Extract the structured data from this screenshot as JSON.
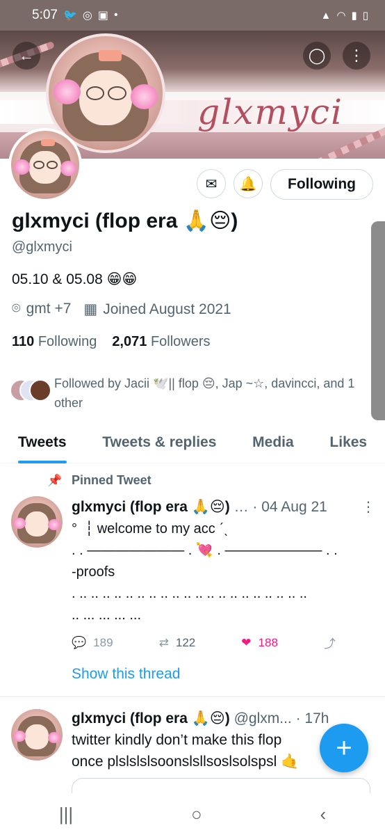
{
  "status_bar": {
    "time": "5:07",
    "left_icons": [
      "twitter-bird-icon",
      "instagram-threads-icon",
      "gallery-icon",
      "dot-icon"
    ],
    "right_icons": [
      "sim-lock-icon",
      "wifi-icon",
      "signal-icon",
      "battery-icon"
    ]
  },
  "banner": {
    "name_text": "glxmyci"
  },
  "header_buttons": {
    "back_icon": "back-arrow-icon",
    "search_icon": "search-icon",
    "more_icon": "more-vertical-icon"
  },
  "profile_actions": {
    "message_icon": "mail-icon",
    "notify_icon": "bell-check-icon",
    "follow_label": "Following"
  },
  "profile": {
    "display_name": "glxmyci (flop era 🙏😔)",
    "handle": "@glxmyci",
    "bio": "05.10 & 05.08 😁😁",
    "location": "gmt +7",
    "joined": "Joined August 2021",
    "following_count": "110",
    "following_label": "Following",
    "followers_count": "2,071",
    "followers_label": "Followers",
    "followed_by": "Followed by Jacii 🕊️|| flop 😔, Jap ~☆, davincci, and 1 other"
  },
  "tabs": [
    {
      "label": "Tweets",
      "active": true
    },
    {
      "label": "Tweets & replies",
      "active": false
    },
    {
      "label": "Media",
      "active": false
    },
    {
      "label": "Likes",
      "active": false
    }
  ],
  "tweets": [
    {
      "pinned_label": "Pinned Tweet",
      "name": "glxmyci (flop era 🙏😔)",
      "meta": "… · 04 Aug 21",
      "text": "°  ︎  ┆ welcome to my acc ˊˎ\n. . ——————— . 💘 . ——————— . .\n-proofs\n. .. .. .. .. .. .. .. .. .. .. .. .. .. .. .. .. .. .. .. ..\n.. ... ... ... ...",
      "replies": "189",
      "retweets": "122",
      "likes": "188",
      "show_thread": "Show this thread"
    },
    {
      "name": "glxmyci (flop era 🙏😔)",
      "meta": "@glxm... · 17h",
      "text": "twitter kindly don’t make this flop\nonce plslslslsoonslsllsoslsolspsl 🤙"
    }
  ],
  "fab": {
    "label": "+"
  },
  "nav_bar": {
    "recent": "|||",
    "home": "○",
    "back": "‹"
  }
}
